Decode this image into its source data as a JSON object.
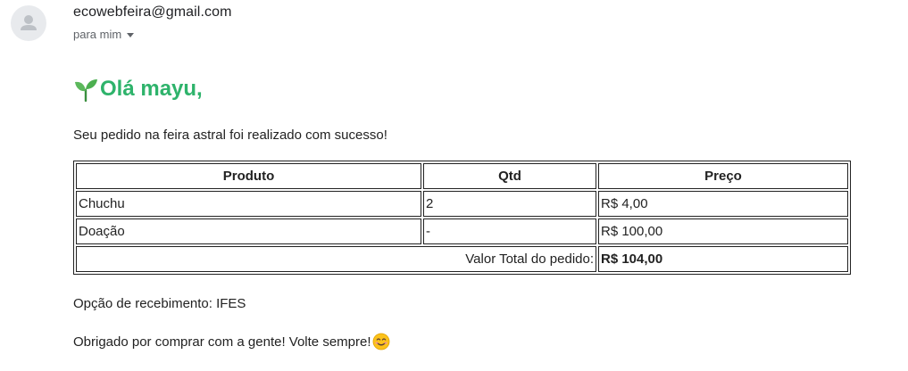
{
  "email": {
    "sender": "ecowebfeira@gmail.com",
    "recipient": "para mim",
    "greeting": "Olá mayu,",
    "message": "Seu pedido na feira astral foi realizado com sucesso!",
    "table": {
      "headers": [
        "Produto",
        "Qtd",
        "Preço"
      ],
      "rows": [
        {
          "produto": "Chuchu",
          "qtd": "2",
          "preco": "R$ 4,00"
        },
        {
          "produto": "Doação",
          "qtd": "-",
          "preco": "R$ 100,00"
        }
      ],
      "total_label": "Valor Total do pedido:",
      "total_value": "R$ 104,00"
    },
    "pickup": "Opção de recebimento: IFES",
    "thanks": "Obrigado por comprar com a gente! Volte sempre!"
  },
  "icons": {
    "avatar": "person-avatar-icon",
    "recipient_caret": "chevron-down-icon",
    "greeting": "seedling-icon",
    "thanks": "smiling-face-icon"
  },
  "colors": {
    "greeting": "#2eb36b",
    "avatar_bg": "#e8eaed",
    "secondary_text": "#5f6368"
  }
}
